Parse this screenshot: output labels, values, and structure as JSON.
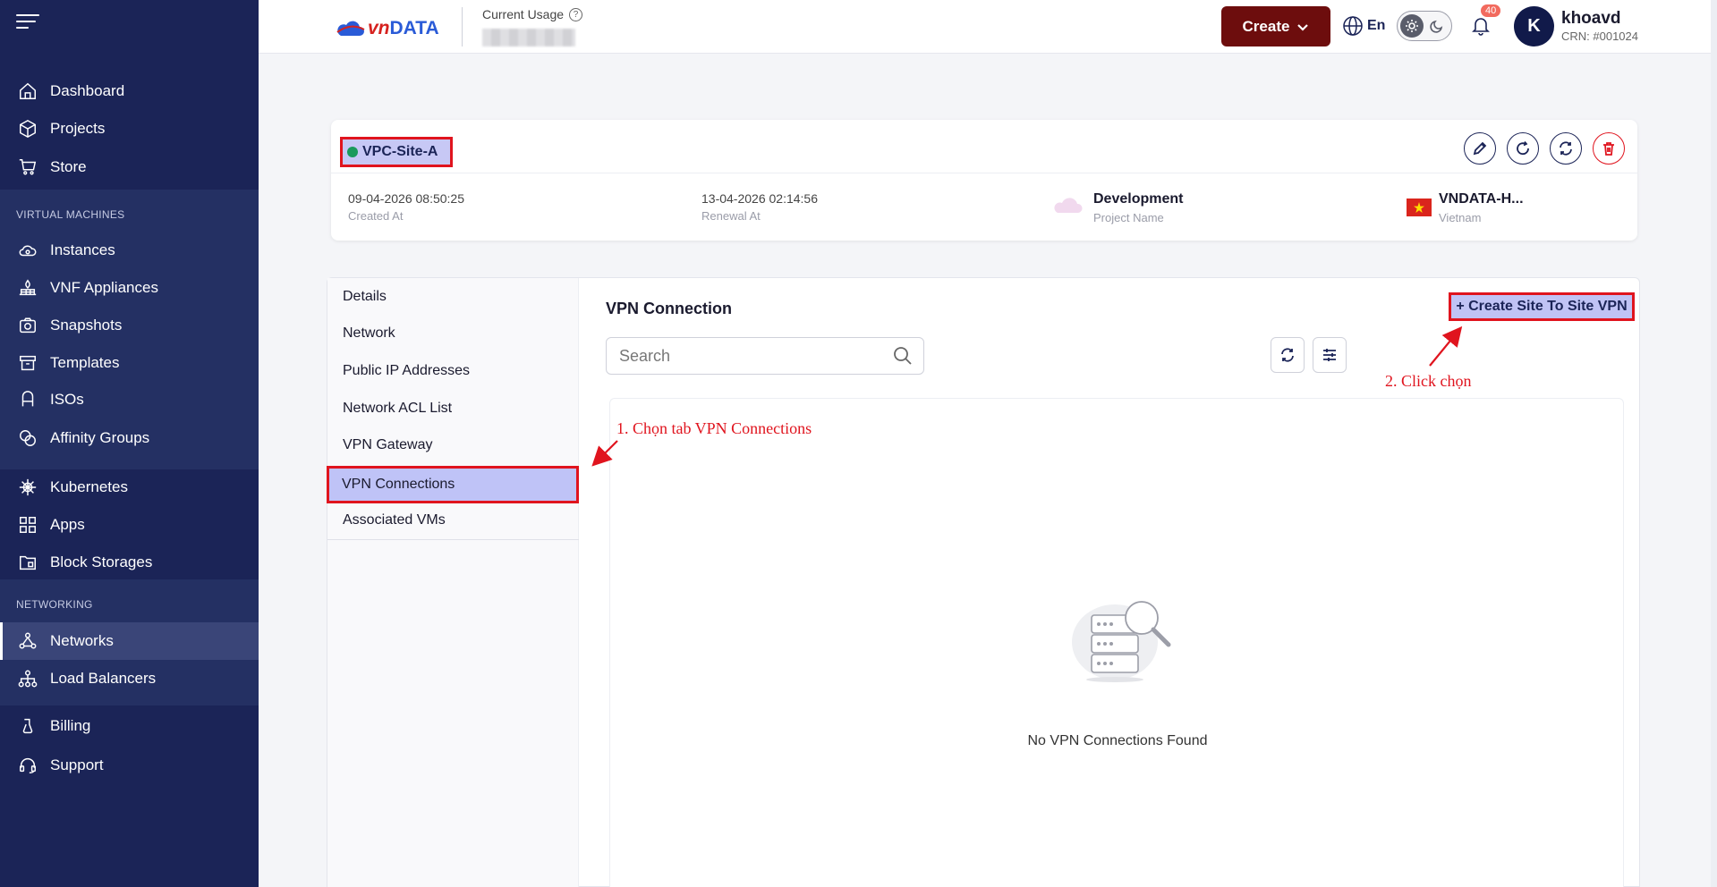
{
  "sidebar": {
    "items_top": [
      {
        "label": "Dashboard",
        "icon": "home-icon"
      },
      {
        "label": "Projects",
        "icon": "cube-icon"
      },
      {
        "label": "Store",
        "icon": "cart-icon"
      }
    ],
    "virtual_machines": {
      "title": "VIRTUAL MACHINES",
      "items": [
        {
          "label": "Instances",
          "icon": "cloud-cog-icon"
        },
        {
          "label": "VNF Appliances",
          "icon": "firewall-icon"
        },
        {
          "label": "Snapshots",
          "icon": "camera-icon"
        },
        {
          "label": "Templates",
          "icon": "archive-icon"
        },
        {
          "label": "ISOs",
          "icon": "disc-icon"
        },
        {
          "label": "Affinity Groups",
          "icon": "group-icon"
        }
      ]
    },
    "items_mid": [
      {
        "label": "Kubernetes",
        "icon": "helm-icon"
      },
      {
        "label": "Apps",
        "icon": "apps-icon"
      },
      {
        "label": "Block Storages",
        "icon": "storage-icon"
      }
    ],
    "networking": {
      "title": "NETWORKING",
      "items": [
        {
          "label": "Networks",
          "icon": "network-icon"
        },
        {
          "label": "Load Balancers",
          "icon": "load-balancer-icon"
        }
      ]
    },
    "items_bottom": [
      {
        "label": "Billing",
        "icon": "billing-icon"
      },
      {
        "label": "Support",
        "icon": "headset-icon"
      }
    ]
  },
  "topbar": {
    "logo_text_vn": "vn",
    "logo_text_data": "DATA",
    "usage_label": "Current Usage",
    "usage_help": "?",
    "create_label": "Create",
    "lang_label": "En",
    "notification_count": "40",
    "avatar_letter": "K",
    "user_name": "khoavd",
    "user_crn": "CRN: #001024"
  },
  "vpc": {
    "name": "VPC-Site-A",
    "created_at_value": "09-04-2026 08:50:25",
    "created_at_label": "Created At",
    "renewal_at_value": "13-04-2026 02:14:56",
    "renewal_at_label": "Renewal At",
    "project_value": "Development",
    "project_label": "Project Name",
    "zone_value": "VNDATA-H...",
    "zone_label": "Vietnam"
  },
  "tabs": [
    {
      "label": "Details"
    },
    {
      "label": "Network"
    },
    {
      "label": "Public IP Addresses"
    },
    {
      "label": "Network ACL List"
    },
    {
      "label": "VPN Gateway"
    },
    {
      "label": "VPN Connections"
    },
    {
      "label": "Associated VMs"
    }
  ],
  "content": {
    "title": "VPN Connection",
    "create_button": "+ Create Site To Site VPN",
    "search_placeholder": "Search",
    "empty_text": "No VPN Connections Found"
  },
  "annotations": {
    "step1": "1. Chọn tab VPN Connections",
    "step2": "2. Click chọn"
  },
  "colors": {
    "sidebar_bg": "#1b2457",
    "create_btn_bg": "#6d0d0d",
    "highlight_fill": "#c0c3f5",
    "annotation_red": "#e0141e",
    "status_green": "#1a9a5c"
  }
}
